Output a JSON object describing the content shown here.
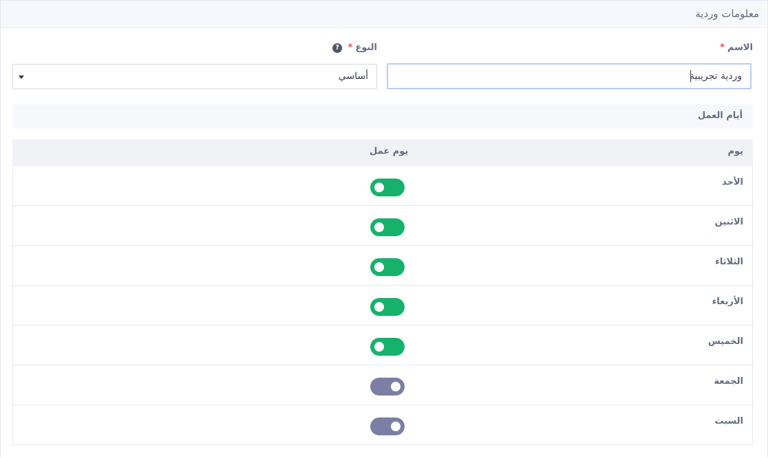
{
  "section": {
    "title": "معلومات وردية"
  },
  "form": {
    "name_label": "الاسم",
    "name_required": "*",
    "name_value": "وردية تجريبية",
    "type_label": "النوع",
    "type_required": "*",
    "type_help_icon": "question-circle-icon",
    "type_help_glyph": "?",
    "type_value": "أساسي"
  },
  "working_days": {
    "title": "أيام العمل",
    "columns": {
      "day": "يوم",
      "work_day": "يوم عمل"
    },
    "rows": [
      {
        "day": "الأحد",
        "work_day": true
      },
      {
        "day": "الاثنين",
        "work_day": true
      },
      {
        "day": "الثلاثاء",
        "work_day": true
      },
      {
        "day": "الأربعاء",
        "work_day": true
      },
      {
        "day": "الخميس",
        "work_day": true
      },
      {
        "day": "الجمعة",
        "work_day": false
      },
      {
        "day": "السبت",
        "work_day": false
      }
    ]
  },
  "colors": {
    "toggle_on": "#16b26b",
    "toggle_off": "#7a7fa3",
    "required": "#e05252",
    "input_focus_border": "#b6cdf3"
  }
}
